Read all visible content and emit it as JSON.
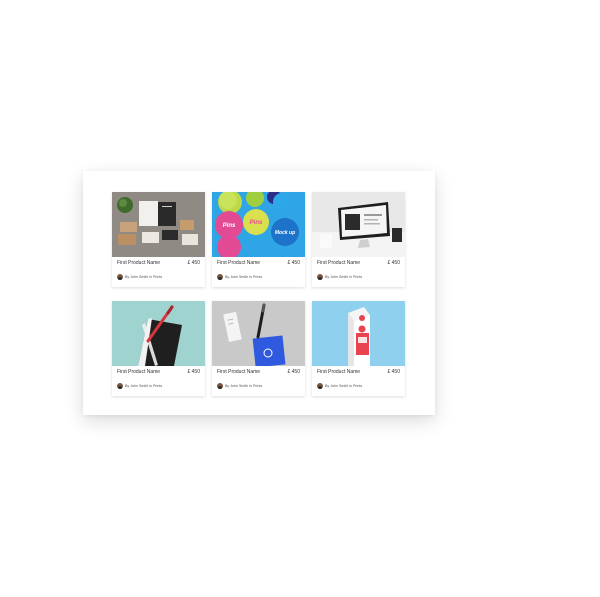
{
  "products": [
    {
      "name": "First Product Name",
      "price": "£ 450",
      "author": "By John Smith in Prints",
      "image": "stationery-mockup"
    },
    {
      "name": "First Product Name",
      "price": "£ 450",
      "author": "By John Smith in Prints",
      "image": "pins-badges-mockup"
    },
    {
      "name": "First Product Name",
      "price": "£ 450",
      "author": "By John Smith in Prints",
      "image": "desktop-monitor-mockup"
    },
    {
      "name": "First Product Name",
      "price": "£ 450",
      "author": "By John Smith in Prints",
      "image": "notebook-pen-mockup"
    },
    {
      "name": "First Product Name",
      "price": "£ 450",
      "author": "By John Smith in Prints",
      "image": "business-card-pen-mockup"
    },
    {
      "name": "First Product Name",
      "price": "£ 450",
      "author": "By John Smith in Prints",
      "image": "milk-carton-mockup"
    }
  ],
  "badge_text": {
    "pins_1": "Pins",
    "pins_2": "Pins",
    "mock_up": "Mock up"
  }
}
